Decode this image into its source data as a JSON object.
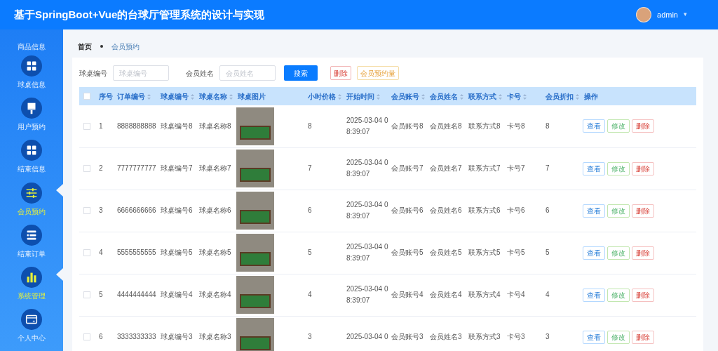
{
  "header": {
    "title": "基于SpringBoot+Vue的台球厅管理系统的设计与实现",
    "user": "admin",
    "caret": "▾"
  },
  "sidebar": {
    "items": [
      {
        "label": "商品信息",
        "selected": false
      },
      {
        "label": "球桌信息",
        "selected": false
      },
      {
        "label": "用户预约",
        "selected": false
      },
      {
        "label": "结束信息",
        "selected": false
      },
      {
        "label": "会员预约",
        "selected": true
      },
      {
        "label": "结束订单",
        "selected": false
      },
      {
        "label": "系统管理",
        "selected": true
      },
      {
        "label": "个人中心",
        "selected": false
      }
    ]
  },
  "breadcrumb": [
    "首页",
    "会员预约"
  ],
  "filters": [
    {
      "label": "球桌编号",
      "placeholder": "球桌编号"
    },
    {
      "label": "会员姓名",
      "placeholder": "会员姓名"
    }
  ],
  "toolbar": [
    {
      "kind": "primary",
      "label": "搜索"
    },
    {
      "kind": "danger",
      "label": "删除"
    },
    {
      "kind": "warning",
      "label": "会员预约量"
    }
  ],
  "table": {
    "all_checked": false,
    "columns": [
      {
        "label": "序号",
        "kind": "text",
        "sortable": false
      },
      {
        "label": "订单编号",
        "kind": "text",
        "sortable": true
      },
      {
        "label": "球桌编号",
        "kind": "text",
        "sortable": true
      },
      {
        "label": "球桌名称",
        "kind": "text",
        "sortable": true
      },
      {
        "label": "球桌图片",
        "kind": "image",
        "sortable": false
      },
      {
        "label": "小时价格",
        "kind": "text",
        "sortable": true
      },
      {
        "label": "开始时间",
        "kind": "text",
        "sortable": true
      },
      {
        "label": "会员账号",
        "kind": "text",
        "sortable": true
      },
      {
        "label": "会员姓名",
        "kind": "text",
        "sortable": true
      },
      {
        "label": "联系方式",
        "kind": "text",
        "sortable": true
      },
      {
        "label": "卡号",
        "kind": "text",
        "sortable": true
      },
      {
        "label": "会员折扣",
        "kind": "text",
        "sortable": true
      },
      {
        "label": "操作",
        "kind": "actions",
        "sortable": false
      }
    ],
    "rows": [
      {
        "checked": false,
        "cells": [
          "1",
          "8888888888",
          "球桌编号8",
          "球桌名称8",
          "",
          "8",
          "2025-03-04 08:39:07",
          "会员账号8",
          "会员姓名8",
          "联系方式8",
          "卡号8",
          "8"
        ],
        "actions": [
          "查看",
          "修改",
          "删除"
        ]
      },
      {
        "checked": false,
        "cells": [
          "2",
          "7777777777",
          "球桌编号7",
          "球桌名称7",
          "",
          "7",
          "2025-03-04 08:39:07",
          "会员账号7",
          "会员姓名7",
          "联系方式7",
          "卡号7",
          "7"
        ],
        "actions": [
          "查看",
          "修改",
          "删除"
        ]
      },
      {
        "checked": false,
        "cells": [
          "3",
          "6666666666",
          "球桌编号6",
          "球桌名称6",
          "",
          "6",
          "2025-03-04 08:39:07",
          "会员账号6",
          "会员姓名6",
          "联系方式6",
          "卡号6",
          "6"
        ],
        "actions": [
          "查看",
          "修改",
          "删除"
        ]
      },
      {
        "checked": false,
        "cells": [
          "4",
          "5555555555",
          "球桌编号5",
          "球桌名称5",
          "",
          "5",
          "2025-03-04 08:39:07",
          "会员账号5",
          "会员姓名5",
          "联系方式5",
          "卡号5",
          "5"
        ],
        "actions": [
          "查看",
          "修改",
          "删除"
        ]
      },
      {
        "checked": false,
        "cells": [
          "5",
          "4444444444",
          "球桌编号4",
          "球桌名称4",
          "",
          "4",
          "2025-03-04 08:39:07",
          "会员账号4",
          "会员姓名4",
          "联系方式4",
          "卡号4",
          "4"
        ],
        "actions": [
          "查看",
          "修改",
          "删除"
        ]
      },
      {
        "checked": false,
        "cells": [
          "6",
          "3333333333",
          "球桌编号3",
          "球桌名称3",
          "",
          "3",
          "2025-03-04 0",
          "会员账号3",
          "会员姓名3",
          "联系方式3",
          "卡号3",
          "3"
        ],
        "actions": [
          "查看",
          "修改",
          "删除"
        ]
      }
    ]
  }
}
